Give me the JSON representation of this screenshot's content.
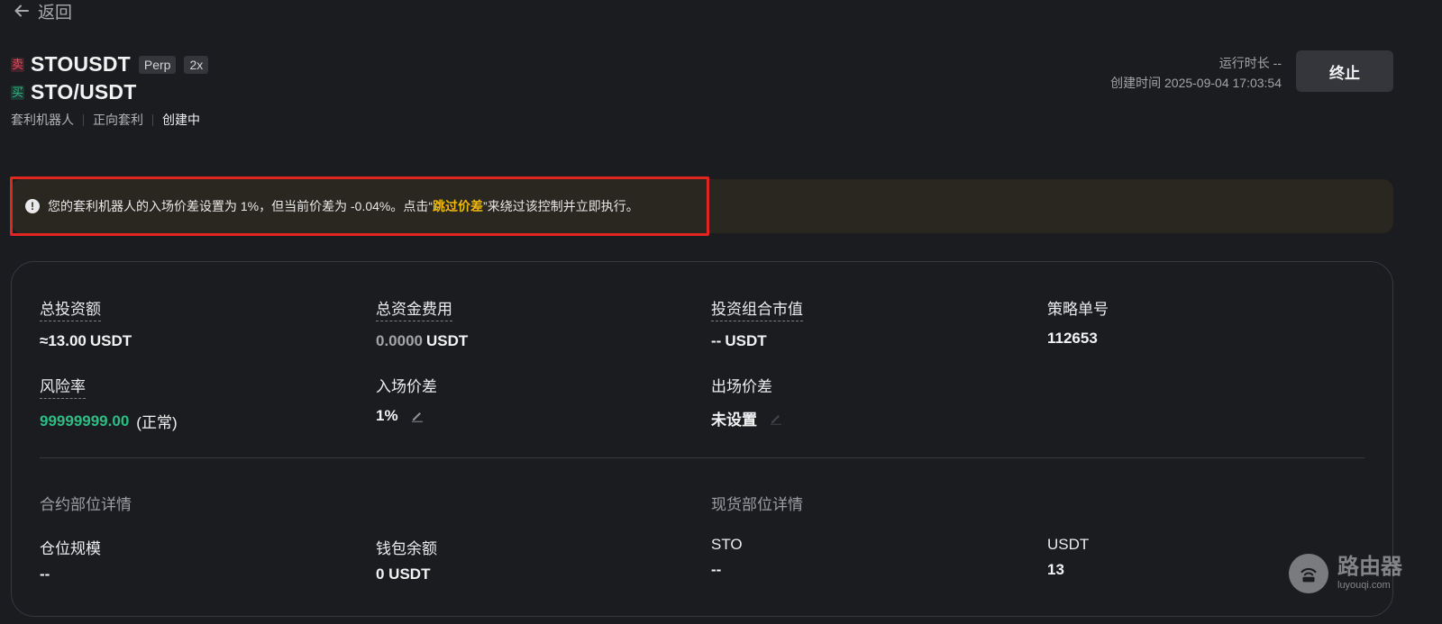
{
  "nav": {
    "back_label": "返回"
  },
  "header": {
    "sell_tag": "卖",
    "buy_tag": "买",
    "perp_symbol": "STOUSDT",
    "perp_chip": "Perp",
    "leverage_chip": "2x",
    "spot_symbol": "STO/USDT",
    "meta": [
      "套利机器人",
      "正向套利",
      "创建中"
    ],
    "runtime": "运行时长 --",
    "created": "创建时间 2025-09-04 17:03:54",
    "stop_button": "终止"
  },
  "notice": {
    "text_before": "您的套利机器人的入场价差设置为 1%，但当前价差为 -0.04%。点击“",
    "link": "跳过价差",
    "text_after": "”来绕过该控制并立即执行。"
  },
  "stats": {
    "total_investment": {
      "label": "总投资额",
      "value": "≈13.00",
      "unit": "USDT"
    },
    "total_funding_fee": {
      "label": "总资金费用",
      "value": "0.0000",
      "unit": "USDT"
    },
    "portfolio_value": {
      "label": "投资组合市值",
      "value": "--",
      "unit": "USDT"
    },
    "strategy_id": {
      "label": "策略单号",
      "value": "112653"
    },
    "risk_rate": {
      "label": "风险率",
      "value": "99999999.00",
      "status": "(正常)"
    },
    "entry_spread": {
      "label": "入场价差",
      "value": "1%"
    },
    "exit_spread": {
      "label": "出场价差",
      "value": "未设置"
    }
  },
  "contract_section": {
    "title": "合约部位详情",
    "position_size": {
      "label": "仓位规模",
      "value": "--"
    },
    "wallet_balance": {
      "label": "钱包余额",
      "value": "0 USDT"
    }
  },
  "spot_section": {
    "title": "现货部位详情",
    "sto": {
      "label": "STO",
      "value": "--"
    },
    "usdt": {
      "label": "USDT",
      "value": "13"
    }
  },
  "watermark": {
    "cn": "路由器",
    "en": "luyouqi.com"
  },
  "colors": {
    "accent": "#f0b90b",
    "sell": "#f6465d",
    "buy": "#2ebd85",
    "alert_border": "#e0261f"
  }
}
